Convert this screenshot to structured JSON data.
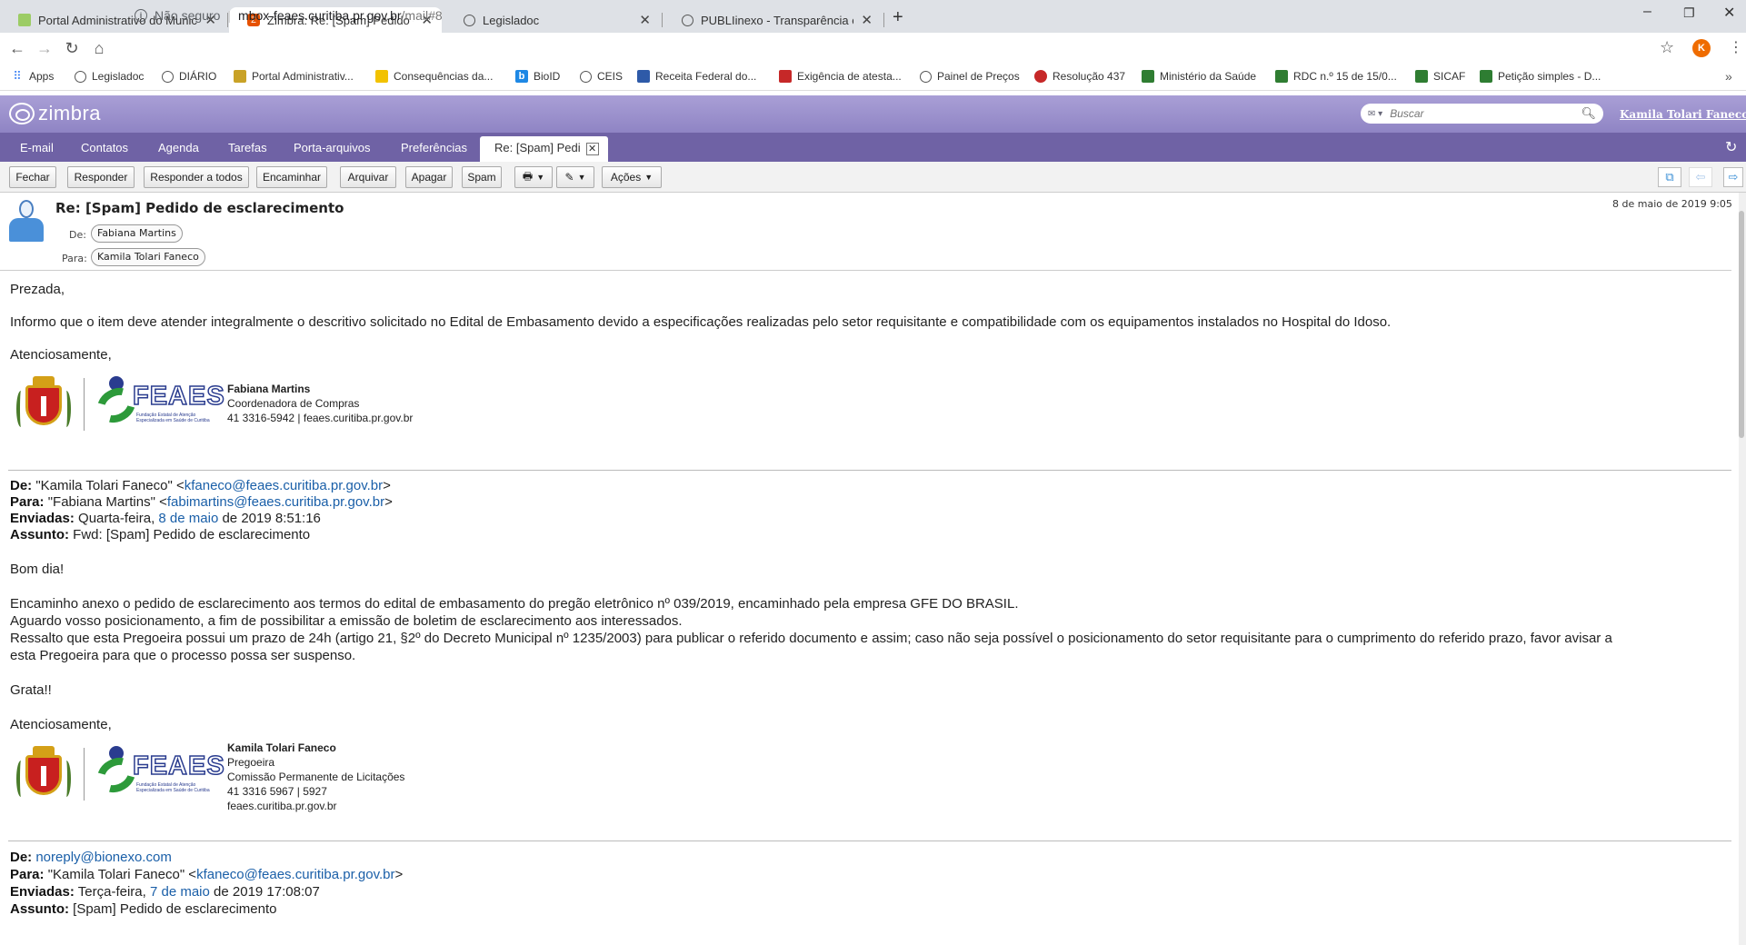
{
  "browser": {
    "tabs": [
      {
        "title": "Portal Administrativo do Municíp",
        "active": false
      },
      {
        "title": "Zimbra: Re: [Spam] Pedido de es",
        "active": true
      },
      {
        "title": "Legisladoc",
        "active": false
      },
      {
        "title": "PUBLIinexo - Transparência em C",
        "active": false
      }
    ],
    "url": {
      "insecure_label": "Não seguro",
      "host": "mbox-feaes.curitiba.pr.gov.br",
      "path": "/mail#8"
    },
    "profile_initial": "K",
    "bookmarks": [
      {
        "label": "Apps",
        "icon": "apps-grid-icon"
      },
      {
        "label": "Legisladoc",
        "icon": "globe-icon"
      },
      {
        "label": "DIÁRIO",
        "icon": "globe-icon"
      },
      {
        "label": "Portal Administrativ...",
        "icon": "folder-icon"
      },
      {
        "label": "Consequências da...",
        "icon": "chart-icon"
      },
      {
        "label": "BioID",
        "icon": "bioid-icon"
      },
      {
        "label": "CEIS",
        "icon": "globe-icon"
      },
      {
        "label": "Receita Federal do...",
        "icon": "receita-icon"
      },
      {
        "label": "Exigência de atesta...",
        "icon": "red-icon"
      },
      {
        "label": "Painel de Preços",
        "icon": "globe-icon"
      },
      {
        "label": "Resolução 437",
        "icon": "crest-icon"
      },
      {
        "label": "Ministério da Saúde",
        "icon": "flag-icon"
      },
      {
        "label": "RDC n.º 15 de 15/0...",
        "icon": "flag-icon"
      },
      {
        "label": "SICAF",
        "icon": "flag-icon"
      },
      {
        "label": "Petição simples - D...",
        "icon": "pen-icon"
      }
    ]
  },
  "zimbra": {
    "logo": "zimbra",
    "search_placeholder": "Buscar",
    "user": "Kamila Tolari Faneco",
    "app_tabs": [
      "E-mail",
      "Contatos",
      "Agenda",
      "Tarefas",
      "Porta-arquivos",
      "Preferências"
    ],
    "open_tab": "Re: [Spam] Pedi",
    "toolbar": {
      "close": "Fechar",
      "reply": "Responder",
      "reply_all": "Responder a todos",
      "forward": "Encaminhar",
      "archive": "Arquivar",
      "delete": "Apagar",
      "spam": "Spam",
      "actions": "Ações"
    }
  },
  "message": {
    "subject": "Re: [Spam] Pedido de esclarecimento",
    "from_label": "De:",
    "from": "Fabiana Martins",
    "to_label": "Para:",
    "to": "Kamila Tolari Faneco",
    "date": "8 de maio de 2019 9:05",
    "greeting": "Prezada,",
    "body": "Informo que o item deve atender integralmente o descritivo solicitado no Edital de Embasamento devido a especificações realizadas pelo setor requisitante e compatibilidade com os equipamentos instalados no Hospital do Idoso.",
    "closing": "Atenciosamente,",
    "signature": {
      "name": "Fabiana Martins",
      "role": "Coordenadora de Compras",
      "contact": "41 3316-5942 | feaes.curitiba.pr.gov.br"
    }
  },
  "quoted1": {
    "from_label": "De:",
    "from_name": "\"Kamila Tolari Faneco\" <",
    "from_email": "kfaneco@feaes.curitiba.pr.gov.br",
    "to_label": "Para:",
    "to_name": "\"Fabiana Martins\" <",
    "to_email": "fabimartins@feaes.curitiba.pr.gov.br",
    "sent_label": "Enviadas:",
    "sent_day": "Quarta-feira, ",
    "sent_date_link": "8 de maio",
    "sent_rest": " de 2019 8:51:16",
    "subject_label": "Assunto:",
    "subject": "Fwd: [Spam] Pedido de esclarecimento",
    "greeting": "Bom dia!",
    "line1": "Encaminho anexo o pedido de esclarecimento aos termos do edital de embasamento do pregão eletrônico nº 039/2019, encaminhado pela empresa GFE DO BRASIL.",
    "line2": "Aguardo vosso posicionamento, a fim de possibilitar a emissão de boletim de esclarecimento aos interessados.",
    "line3": "Ressalto que esta Pregoeira possui um prazo de 24h (artigo 21, §2º do Decreto Municipal nº 1235/2003) para publicar o referido documento e assim; caso não seja possível o posicionamento do setor requisitante para o cumprimento do referido prazo, favor avisar a",
    "line4": "esta Pregoeira para que o processo possa ser suspenso.",
    "thanks": "Grata!!",
    "closing": "Atenciosamente,",
    "signature": {
      "name": "Kamila Tolari Faneco",
      "role": "Pregoeira",
      "dept": "Comissão Permanente de Licitações",
      "phone": "41 3316 5967 | 5927",
      "site": "feaes.curitiba.pr.gov.br"
    }
  },
  "quoted2": {
    "from_label": "De:",
    "from_email": "noreply@bionexo.com",
    "to_label": "Para:",
    "to_name": "\"Kamila Tolari Faneco\" <",
    "to_email": "kfaneco@feaes.curitiba.pr.gov.br",
    "sent_label": "Enviadas:",
    "sent_day": "Terça-feira, ",
    "sent_date_link": "7 de maio",
    "sent_rest": " de 2019 17:08:07",
    "subject_label": "Assunto:",
    "subject": "[Spam] Pedido de esclarecimento"
  },
  "logo": {
    "feaes_word": "FEAES",
    "feaes_tag": "Fundação Estatal de Atenção Especializada em Saúde de Curitiba"
  }
}
